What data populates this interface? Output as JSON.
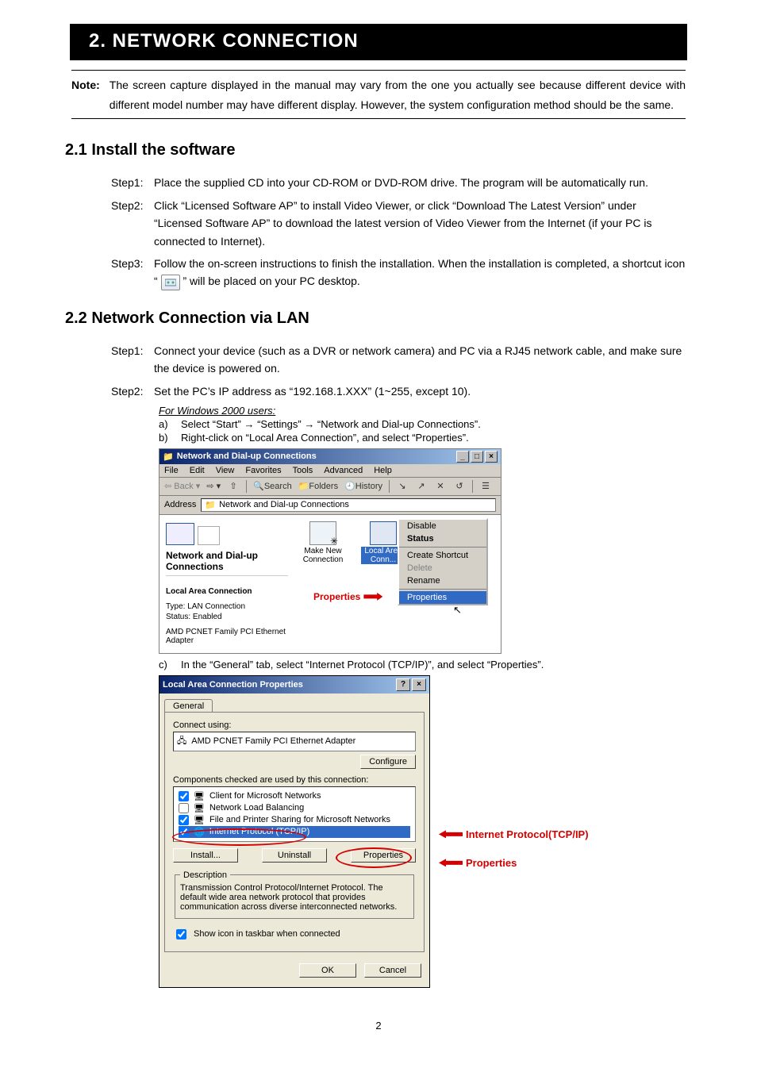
{
  "chapter_title": "2. NETWORK CONNECTION",
  "note_label": "Note:",
  "note_body": "The screen capture displayed in the manual may vary from the one you actually see because different device with different model number may have different display. However, the system configuration method should be the same.",
  "sec21_title": "2.1 Install the software",
  "sec21_steps": {
    "s1_label": "Step1:",
    "s1_body": "Place the supplied CD into your CD-ROM or DVD-ROM drive. The program will be automatically run.",
    "s2_label": "Step2:",
    "s2_body": "Click “Licensed Software AP” to install Video Viewer, or click “Download The Latest Version” under “Licensed Software AP” to download the latest version of Video Viewer from the Internet (if your PC is connected to Internet).",
    "s3_label": "Step3:",
    "s3_body_before": "Follow the on-screen instructions to finish the installation. When the installation is completed, a shortcut icon “",
    "s3_body_after": "” will be placed on your PC desktop."
  },
  "sec22_title": "2.2 Network Connection via LAN",
  "sec22_steps": {
    "s1_label": "Step1:",
    "s1_body": "Connect your device (such as a DVR or network camera) and PC via a RJ45 network cable, and make sure the device is powered on.",
    "s2_label": "Step2:",
    "s2_body": "Set the PC’s IP address as “192.168.1.XXX” (1~255, except 10).",
    "s2_sub_title": "For Windows 2000 users:",
    "a_label": "a)",
    "a_body": "Select “Start” → “Settings” → “Network and Dial-up Connections”.",
    "b_label": "b)",
    "b_body": "Right-click on “Local Area Connection”, and select “Properties”.",
    "c_label": "c)",
    "c_body": "In the “General” tab, select “Internet Protocol (TCP/IP)”, and select “Properties”."
  },
  "screenshot1": {
    "window_title": "Network and Dial-up Connections",
    "menus": [
      "File",
      "Edit",
      "View",
      "Favorites",
      "Tools",
      "Advanced",
      "Help"
    ],
    "tb_back": "Back",
    "tb_search": "Search",
    "tb_folders": "Folders",
    "tb_history": "History",
    "addr_label": "Address",
    "addr_value": "Network and Dial-up Connections",
    "left_title": "Network and Dial-up Connections",
    "left_sel_label": "Local Area Connection",
    "left_type": "Type: LAN Connection",
    "left_status": "Status: Enabled",
    "left_adapter": "AMD PCNET Family PCI Ethernet Adapter",
    "icon1": "Make New Connection",
    "icon2": "Local Area Conn...",
    "ctx": {
      "disable": "Disable",
      "status": "Status",
      "shortcut": "Create Shortcut",
      "delete": "Delete",
      "rename": "Rename",
      "properties": "Properties"
    },
    "callout": "Properties"
  },
  "screenshot2": {
    "window_title": "Local Area Connection Properties",
    "tab": "General",
    "connect_using": "Connect using:",
    "adapter": "AMD PCNET Family PCI Ethernet Adapter",
    "configure": "Configure",
    "components_lbl": "Components checked are used by this connection:",
    "items": {
      "i1": "Client for Microsoft Networks",
      "i2": "Network Load Balancing",
      "i3": "File and Printer Sharing for Microsoft Networks",
      "i4": "Internet Protocol (TCP/IP)"
    },
    "install": "Install...",
    "uninstall": "Uninstall",
    "properties": "Properties",
    "desc_legend": "Description",
    "desc_body": "Transmission Control Protocol/Internet Protocol. The default wide area network protocol that provides communication across diverse interconnected networks.",
    "show_icon": "Show icon in taskbar when connected",
    "ok": "OK",
    "cancel": "Cancel",
    "callout_ip": "Internet Protocol(TCP/IP)",
    "callout_prop": "Properties"
  },
  "page_number": "2"
}
